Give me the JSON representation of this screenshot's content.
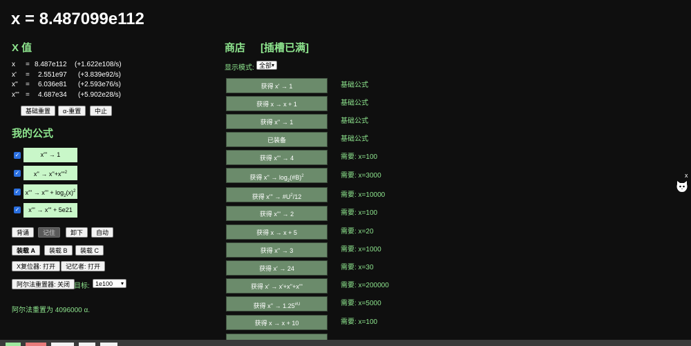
{
  "header": {
    "title": "x = 8.487099e112"
  },
  "x_values": {
    "section_title": "X 值",
    "rows": [
      {
        "name": "x",
        "eq": "=",
        "value": "8.487e112",
        "rate": "(+1.622e108/s)"
      },
      {
        "name": "x'",
        "eq": "=",
        "value": "2.551e97",
        "rate": "(+3.839e92/s)"
      },
      {
        "name": "x''",
        "eq": "=",
        "value": "6.036e81",
        "rate": "(+2.593e76/s)"
      },
      {
        "name": "x'''",
        "eq": "=",
        "value": "4.687e34",
        "rate": "(+5.902e28/s)"
      }
    ],
    "buttons": {
      "basic_reset": "基础重置",
      "alpha_reset": "α-重置",
      "stop": "中止"
    }
  },
  "my_formulas": {
    "section_title": "我的公式",
    "items": [
      {
        "checked": true,
        "parts": [
          "x''' → 1"
        ]
      },
      {
        "checked": true,
        "parts": [
          "x'' → x''+x'''",
          "2"
        ]
      },
      {
        "checked": true,
        "parts": [
          "x''' → x''' + log",
          "2",
          "(x)",
          "2"
        ]
      },
      {
        "checked": true,
        "parts": [
          "x''' → x''' + 5e21"
        ]
      }
    ],
    "actions": {
      "memorize_back": "背诵",
      "remember": "记住",
      "unload": "卸下",
      "auto": "自动"
    },
    "loadouts": {
      "a": "装载 A",
      "b": "装载 B",
      "c": "装载 C"
    },
    "toggles": {
      "x_resetter": "X复位器: 打开",
      "memorizer": "记忆者: 打开"
    },
    "alpha_resetter": {
      "button": "阿尔法重置器: 关闭",
      "target_label": "目标:",
      "target_value": "1e100"
    },
    "status": "阿尔法重置为 4096000 α."
  },
  "shop": {
    "title": "商店",
    "slots_full": "[插槽已满]",
    "display_mode_label": "显示模式:",
    "display_mode_value": "全部",
    "items": [
      {
        "parts": [
          "获得 x' → 1"
        ],
        "label": "基础公式"
      },
      {
        "parts": [
          "获得 x → x + 1"
        ],
        "label": "基础公式"
      },
      {
        "parts": [
          "获得 x'' → 1"
        ],
        "label": "基础公式"
      },
      {
        "parts": [
          "已装备"
        ],
        "label": "基础公式"
      },
      {
        "parts": [
          "获得 x''' → 4"
        ],
        "label": "需要: x=100"
      },
      {
        "parts": [
          "获得 x'' → log",
          "2",
          "(#B)",
          "2"
        ],
        "label": "需要: x=3000"
      },
      {
        "parts": [
          "获得 x''' → #U",
          "2",
          "/12"
        ],
        "label": "需要: x=10000"
      },
      {
        "parts": [
          "获得 x''' → 2"
        ],
        "label": "需要: x=100"
      },
      {
        "parts": [
          "获得 x → x + 5"
        ],
        "label": "需要: x=20"
      },
      {
        "parts": [
          "获得 x'' → 3"
        ],
        "label": "需要: x=1000"
      },
      {
        "parts": [
          "获得 x' → 24"
        ],
        "label": "需要: x=30"
      },
      {
        "parts": [
          "获得 x' → x'+x''+x'''"
        ],
        "label": "需要: x=200000"
      },
      {
        "parts": [
          "获得 x'' → 1.25",
          "#U"
        ],
        "label": "需要: x=5000"
      },
      {
        "parts": [
          "获得 x → x + 10"
        ],
        "label": "需要: x=100"
      }
    ]
  },
  "colors": {
    "accent_green": "#8ee58e",
    "formula_box": "#c9f7c9",
    "shop_button": "#6b8b6b",
    "background": "#0f0f0f"
  },
  "widget": {
    "icon": "cat-icon",
    "close": "x"
  }
}
